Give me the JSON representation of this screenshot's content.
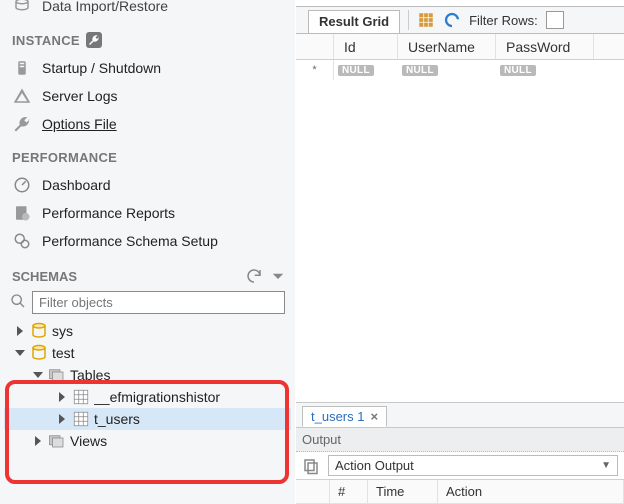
{
  "sidebar": {
    "top_partial_item": "Data Import/Restore",
    "instance_header": "INSTANCE",
    "instance_items": [
      {
        "label": "Startup / Shutdown"
      },
      {
        "label": "Server Logs"
      },
      {
        "label": "Options File"
      }
    ],
    "performance_header": "PERFORMANCE",
    "performance_items": [
      {
        "label": "Dashboard"
      },
      {
        "label": "Performance Reports"
      },
      {
        "label": "Performance Schema Setup"
      }
    ],
    "schemas_header": "SCHEMAS",
    "filter_placeholder": "Filter objects",
    "tree": {
      "sys": "sys",
      "test": "test",
      "tables": "Tables",
      "efm": "__efmigrationshistor",
      "tusers": "t_users",
      "views": "Views"
    }
  },
  "result_grid": {
    "tab_label": "Result Grid",
    "filter_label": "Filter Rows:",
    "columns": {
      "id": "Id",
      "user": "UserName",
      "pass": "PassWord"
    },
    "null_text": "NULL",
    "row_marker": "*"
  },
  "editor_tab": {
    "label": "t_users 1"
  },
  "output": {
    "title": "Output",
    "selector": "Action Output",
    "columns": {
      "hash": "#",
      "time": "Time",
      "action": "Action"
    }
  }
}
